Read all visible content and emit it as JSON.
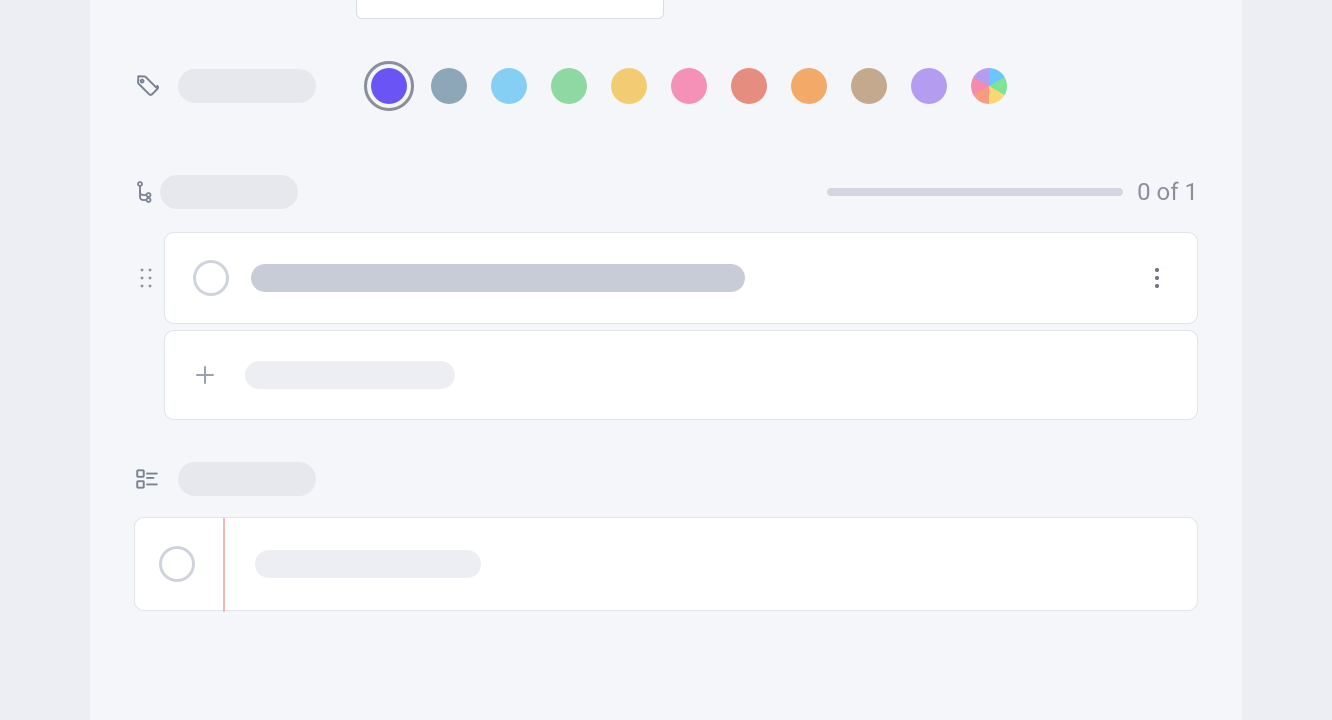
{
  "colors": {
    "selected_index": 0,
    "options": [
      "#6a54f4",
      "#8da7b8",
      "#86cff4",
      "#8fd8a3",
      "#f3cb72",
      "#f590b6",
      "#e58d7f",
      "#f3a968",
      "#c4a98f",
      "#b49df0",
      "rainbow"
    ]
  },
  "subtasks": {
    "progress_text": "0 of 1",
    "completed": 0,
    "total": 1
  }
}
